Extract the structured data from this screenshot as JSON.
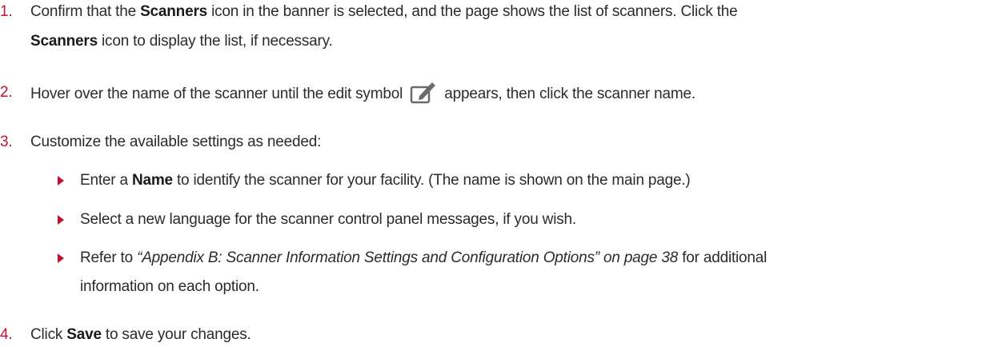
{
  "steps": [
    {
      "number": "1.",
      "line1_pre": "Confirm that the ",
      "line1_bold": "Scanners",
      "line1_post": " icon in the banner is selected, and the page shows the list of scanners. Click the",
      "line2_bold": "Scanners",
      "line2_post": " icon to display the list, if necessary."
    },
    {
      "number": "2.",
      "pre": "Hover over the name of the scanner until the edit symbol",
      "icon": "edit-icon",
      "post": "appears, then click the scanner name."
    },
    {
      "number": "3.",
      "text": "Customize the available settings as needed:",
      "bullets": [
        {
          "pre": "Enter a ",
          "bold": "Name",
          "post": " to identify the scanner for your facility. (The name is shown on the main page.)"
        },
        {
          "text": "Select a new language for the scanner control panel messages, if you wish."
        },
        {
          "pre": "Refer to ",
          "italic": "“Appendix B: Scanner Information Settings and Configuration Options” on page 38",
          "post": " for additional",
          "line2": "information on each option."
        }
      ]
    },
    {
      "number": "4.",
      "pre": "Click ",
      "bold": "Save",
      "post": " to save your changes."
    }
  ],
  "colors": {
    "step_number": "#c8102e",
    "bullet": "#c8102e",
    "text": "#2b2b2b"
  }
}
